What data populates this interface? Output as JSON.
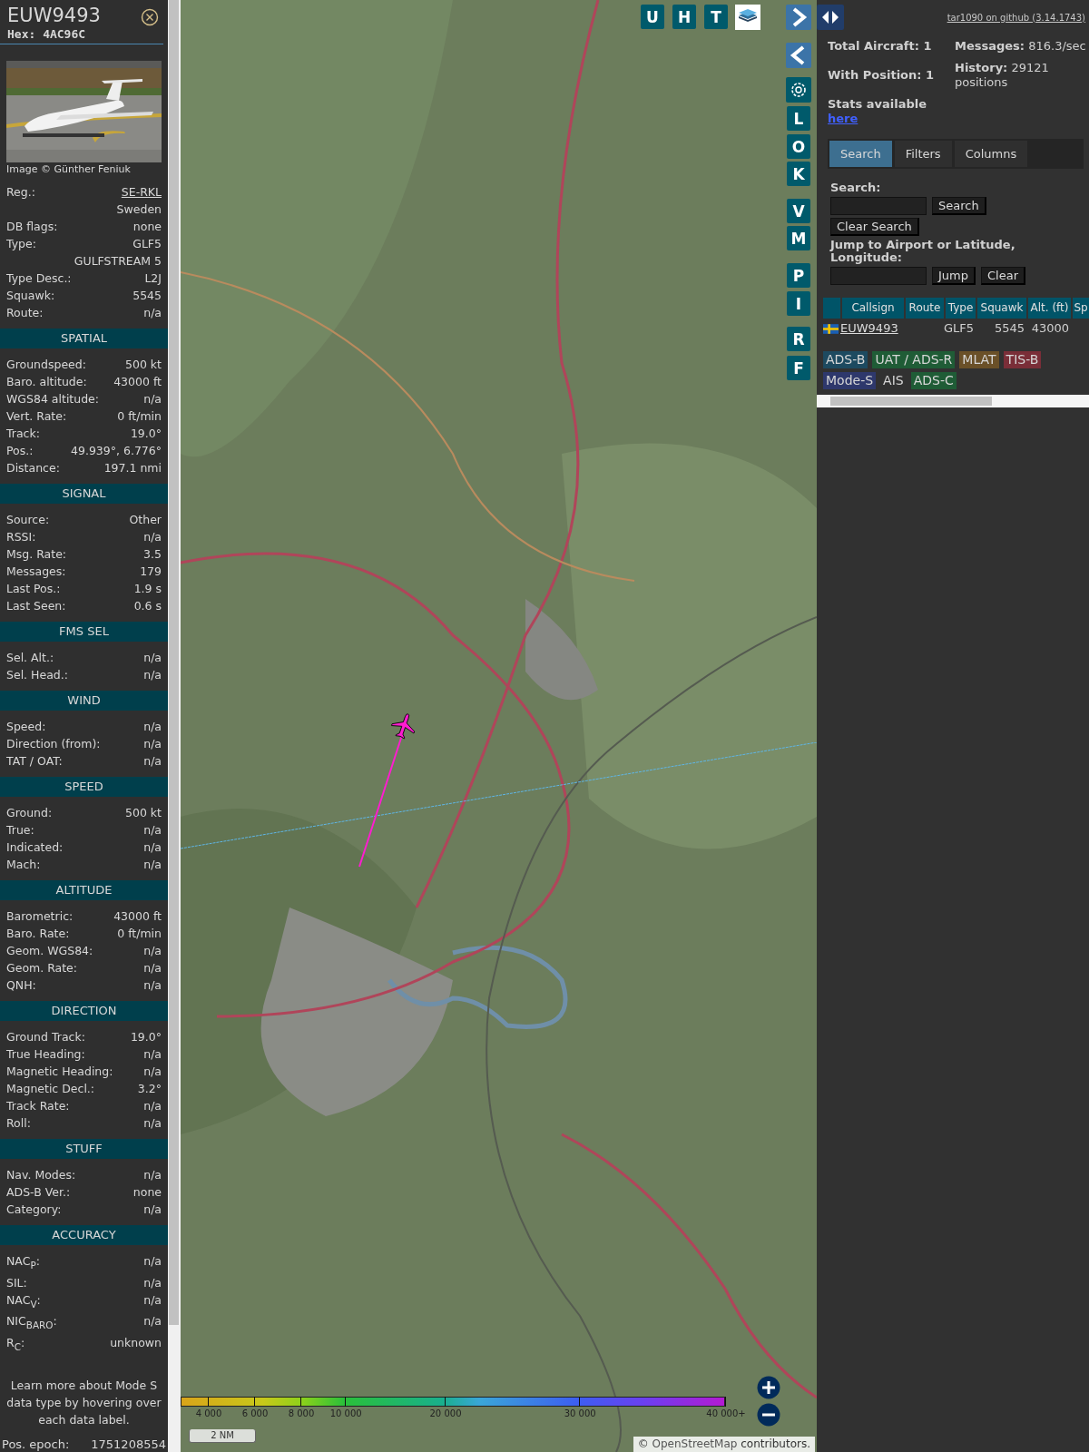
{
  "detail": {
    "callsign": "EUW9493",
    "hex": "Hex: 4AC96C",
    "photo_credit": "Image © Günther Feniuk",
    "groups": [
      {
        "rows": [
          {
            "label": "Reg.:",
            "value": "SE-RKL",
            "link": true
          },
          {
            "value": "Sweden",
            "link": false
          },
          {
            "label": "DB flags:",
            "value": "none",
            "link": false
          },
          {
            "label": "Type:",
            "value": "GLF5",
            "link": false
          },
          {
            "value": "GULFSTREAM 5",
            "link": false
          },
          {
            "label": "Type Desc.:",
            "value": "L2J",
            "link": false
          },
          {
            "label": "Squawk:",
            "value": "5545",
            "link": false
          },
          {
            "label": "Route:",
            "value": "n/a",
            "link": false
          }
        ]
      },
      {
        "title": "SPATIAL",
        "rows": [
          {
            "label": "Groundspeed:",
            "value": "500 kt",
            "link": false
          },
          {
            "label": "Baro. altitude:",
            "value": "43000 ft",
            "link": false
          },
          {
            "label": "WGS84 altitude:",
            "value": "n/a",
            "link": false
          },
          {
            "label": "Vert. Rate:",
            "value": "0 ft/min",
            "link": false
          },
          {
            "label": "Track:",
            "value": "19.0°",
            "link": false
          },
          {
            "label": "Pos.:",
            "value": "49.939°, 6.776°",
            "link": false
          },
          {
            "label": "Distance:",
            "value": "197.1 nmi",
            "link": false
          }
        ]
      },
      {
        "title": "SIGNAL",
        "rows": [
          {
            "label": "Source:",
            "value": "Other",
            "link": false
          },
          {
            "label": "RSSI:",
            "value": "n/a",
            "link": false
          },
          {
            "label": "Msg. Rate:",
            "value": "3.5",
            "link": false
          },
          {
            "label": "Messages:",
            "value": "179",
            "link": false
          },
          {
            "label": "Last Pos.:",
            "value": "1.9 s",
            "link": false
          },
          {
            "label": "Last Seen:",
            "value": "0.6 s",
            "link": false
          }
        ]
      },
      {
        "title": "FMS SEL",
        "rows": [
          {
            "label": "Sel. Alt.:",
            "value": "n/a",
            "link": false
          },
          {
            "label": "Sel. Head.:",
            "value": "n/a",
            "link": false
          }
        ]
      },
      {
        "title": "WIND",
        "rows": [
          {
            "label": "Speed:",
            "value": "n/a",
            "link": false
          },
          {
            "label": "Direction (from):",
            "value": "n/a",
            "link": false
          },
          {
            "label": "TAT / OAT:",
            "value": "n/a",
            "link": false
          }
        ]
      },
      {
        "title": "SPEED",
        "rows": [
          {
            "label": "Ground:",
            "value": "500 kt",
            "link": false
          },
          {
            "label": "True:",
            "value": "n/a",
            "link": false
          },
          {
            "label": "Indicated:",
            "value": "n/a",
            "link": false
          },
          {
            "label": "Mach:",
            "value": "n/a",
            "link": false
          }
        ]
      },
      {
        "title": "ALTITUDE",
        "rows": [
          {
            "label": "Barometric:",
            "value": "43000 ft",
            "link": false
          },
          {
            "label": "Baro. Rate:",
            "value": "0 ft/min",
            "link": false
          },
          {
            "label": "Geom. WGS84:",
            "value": "n/a",
            "link": false
          },
          {
            "label": "Geom. Rate:",
            "value": "n/a",
            "link": false
          },
          {
            "label": "QNH:",
            "value": "n/a",
            "link": false
          }
        ]
      },
      {
        "title": "DIRECTION",
        "rows": [
          {
            "label": "Ground Track:",
            "value": "19.0°",
            "link": false
          },
          {
            "label": "True Heading:",
            "value": "n/a",
            "link": false
          },
          {
            "label": "Magnetic Heading:",
            "value": "n/a",
            "link": false
          },
          {
            "label": "Magnetic Decl.:",
            "value": "3.2°",
            "link": false
          },
          {
            "label": "Track Rate:",
            "value": "n/a",
            "link": false
          },
          {
            "label": "Roll:",
            "value": "n/a",
            "link": false
          }
        ]
      },
      {
        "title": "STUFF",
        "rows": [
          {
            "label": "Nav. Modes:",
            "value": "n/a",
            "link": false
          },
          {
            "label": "ADS-B Ver.:",
            "value": "none",
            "link": false
          },
          {
            "label": "Category:",
            "value": "n/a",
            "link": false
          }
        ]
      },
      {
        "title": "ACCURACY",
        "rows": [
          {
            "label": "NAC$_{P}$:",
            "value": "n/a",
            "link": false
          },
          {
            "label": "SIL:",
            "value": "n/a",
            "link": false
          },
          {
            "label": "NAC$_{V}$:",
            "value": "n/a",
            "link": false
          },
          {
            "label": "NIC$_{BARO}$:",
            "value": "n/a",
            "link": false
          },
          {
            "label": "R$_{C}$:",
            "value": "unknown",
            "link": false
          }
        ]
      }
    ],
    "note": "Learn more about Mode S data type by hovering over each data label.",
    "epoch": {
      "label": "Pos. epoch:",
      "value": "1751208554"
    }
  },
  "map": {
    "top_buttons": [
      "U",
      "H",
      "T"
    ],
    "side_buttons": [
      "L",
      "O",
      "K",
      "V",
      "M",
      "P",
      "I",
      "R",
      "F"
    ],
    "altitude_legend": [
      "4 000",
      "6 000",
      "8 000",
      "10 000",
      "20 000",
      "30 000",
      "40 000+"
    ],
    "scale": "2 NM",
    "attribution": {
      "prefix": "©",
      "link": "OpenStreetMap",
      "suffix": "contributors."
    }
  },
  "panel": {
    "github_link": "tar1090 on github (3.14.1743)",
    "total_aircraft": "Total Aircraft: 1",
    "messages": "**Messages:** 816.3/sec",
    "with_position": "With Position: 1",
    "history": "**History:** 29121 positions",
    "stats_text": "Stats available",
    "stats_link": "here",
    "tabs": [
      {
        "label": "Search",
        "selected": true
      },
      {
        "label": "Filters",
        "selected": false
      },
      {
        "label": "Columns",
        "selected": false
      }
    ],
    "search": {
      "label": "Search:",
      "button": "Search",
      "clear_button": "Clear Search"
    },
    "jump": {
      "label": "Jump to Airport or Latitude, Longitude:",
      "button": "Jump",
      "clear_button": "Clear"
    },
    "table": {
      "columns": [
        "Callsign",
        "Route",
        "Type",
        "Squawk",
        "Alt. (ft)",
        "Sp"
      ],
      "rows": [
        {
          "callsign": "EUW9493",
          "type": "GLF5",
          "squawk": "5545",
          "altitude": "43000"
        }
      ]
    },
    "sources": [
      {
        "label": "ADS-B",
        "color": "#1d4a60"
      },
      {
        "label": "UAT / ADS-R",
        "color": "#1f5c36"
      },
      {
        "label": "MLAT",
        "color": "#6a5028"
      },
      {
        "label": "TIS-B",
        "color": "#7a2e38"
      },
      {
        "label": "Mode-S",
        "color": "#2e386c"
      },
      {
        "label": "AIS"
      },
      {
        "label": "ADS-C",
        "color": "#1f5c36"
      }
    ]
  }
}
